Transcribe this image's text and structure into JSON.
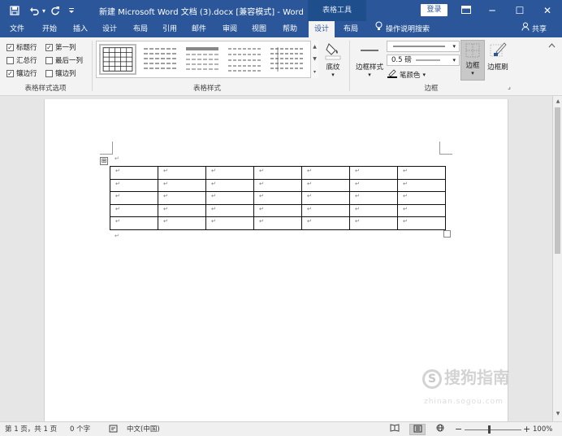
{
  "titlebar": {
    "save_icon": "save-icon",
    "undo_icon": "undo-icon",
    "undo_dropdown": "▾",
    "redo_icon": "redo-icon",
    "customize_icon": "customize-quick-access-icon",
    "title": "新建 Microsoft Word 文档 (3).docx [兼容模式] - Word",
    "context_tab": "表格工具",
    "login": "登录",
    "ribbon_display_icon": "ribbon-display-options-icon",
    "minimize": "─",
    "maximize": "☐",
    "close": "✕"
  },
  "menu": {
    "items": [
      "文件",
      "开始",
      "插入",
      "设计",
      "布局",
      "引用",
      "邮件",
      "审阅",
      "视图",
      "帮助",
      "设计",
      "布局"
    ],
    "active_index": 10,
    "tell_me": "操作说明搜索",
    "share": "共享"
  },
  "ribbon": {
    "style_options": {
      "header_row": "标题行",
      "first_column": "第一列",
      "total_row": "汇总行",
      "last_column": "最后一列",
      "banded_rows": "镶边行",
      "banded_columns": "镶边列",
      "checked": {
        "header_row": true,
        "first_column": true,
        "total_row": false,
        "last_column": false,
        "banded_rows": true,
        "banded_columns": false
      },
      "group_label": "表格样式选项"
    },
    "table_styles": {
      "group_label": "表格样式"
    },
    "shading": {
      "label": "底纹",
      "arrow": "▾"
    },
    "borders": {
      "border_styles": "边框样式",
      "border_styles_arrow": "▾",
      "line_weight": "0.5 磅",
      "pen_color": "笔颜色",
      "pen_color_arrow": "▾",
      "border": "边框",
      "border_arrow": "▾",
      "border_painter": "边框刷",
      "group_label": "边框",
      "launcher": "⌟"
    }
  },
  "document": {
    "paragraph_mark": "↵",
    "table_move_handle": "⊞",
    "rows": 5,
    "cols": 7
  },
  "watermark": {
    "main": "搜狗指南",
    "circle": "S",
    "sub": "zhinan.sogou.com"
  },
  "statusbar": {
    "page": "第 1 页，共 1 页",
    "words": "0 个字",
    "proofing_icon": "proofing-icon",
    "language": "中文(中国)",
    "read_mode_icon": "read-mode-icon",
    "print_layout_icon": "print-layout-icon",
    "web_layout_icon": "web-layout-icon",
    "zoom_out": "−",
    "zoom_in": "+",
    "zoom": "100%"
  },
  "colors": {
    "accent": "#2b579a"
  }
}
